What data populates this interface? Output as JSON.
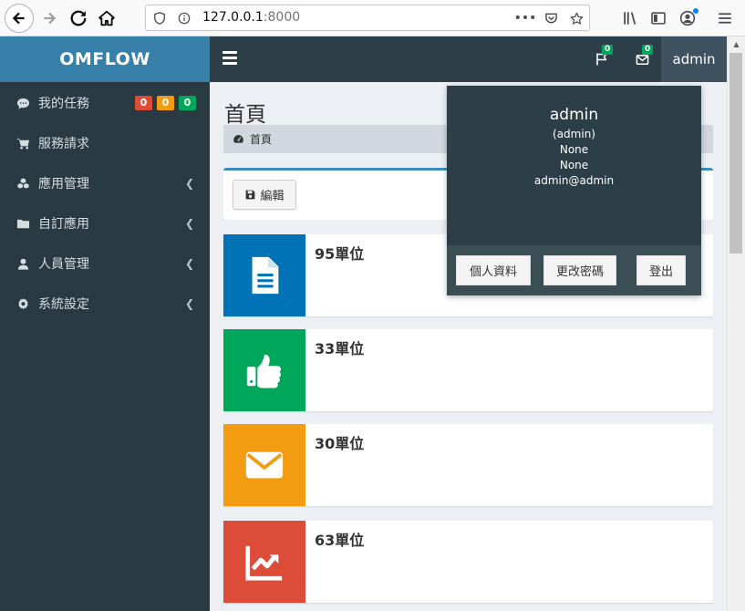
{
  "browser": {
    "url_host": "127.0.0.1",
    "url_port": ":8000"
  },
  "app": {
    "logo": "OMFLOW",
    "flag_count": "0",
    "mail_count": "0",
    "user_button": "admin"
  },
  "sidebar": {
    "items": [
      {
        "label": "我的任務",
        "icon": "comment-icon"
      },
      {
        "label": "服務請求",
        "icon": "cart-icon"
      },
      {
        "label": "應用管理",
        "icon": "cubes-icon"
      },
      {
        "label": "自訂應用",
        "icon": "folder-icon"
      },
      {
        "label": "人員管理",
        "icon": "user-icon"
      },
      {
        "label": "系統設定",
        "icon": "gear-icon"
      }
    ],
    "task_badges": [
      {
        "value": "0",
        "color": "#dd4b39"
      },
      {
        "value": "0",
        "color": "#f39c12"
      },
      {
        "value": "0",
        "color": "#00a65a"
      }
    ]
  },
  "content": {
    "title": "首頁",
    "breadcrumb": "首頁",
    "edit_label": "編輯",
    "info_boxes": [
      {
        "value": "95單位",
        "color": "#0073b7",
        "icon": "file-icon"
      },
      {
        "value": "33單位",
        "color": "#00a65a",
        "icon": "thumbs-up-icon"
      },
      {
        "value": "30單位",
        "color": "#f39c12",
        "icon": "envelope-icon"
      },
      {
        "value": "63單位",
        "color": "#dd4b39",
        "icon": "chart-line-icon"
      }
    ]
  },
  "user_dropdown": {
    "name": "admin",
    "lines": [
      "(admin)",
      "None",
      "None",
      "admin@admin"
    ],
    "buttons": {
      "profile": "個人資料",
      "change_password": "更改密碼",
      "logout": "登出"
    }
  },
  "colors": {
    "logo_bg": "#367fa9",
    "topbar_bg": "#2c3e47",
    "sidebar_bg": "#2a3a42"
  }
}
